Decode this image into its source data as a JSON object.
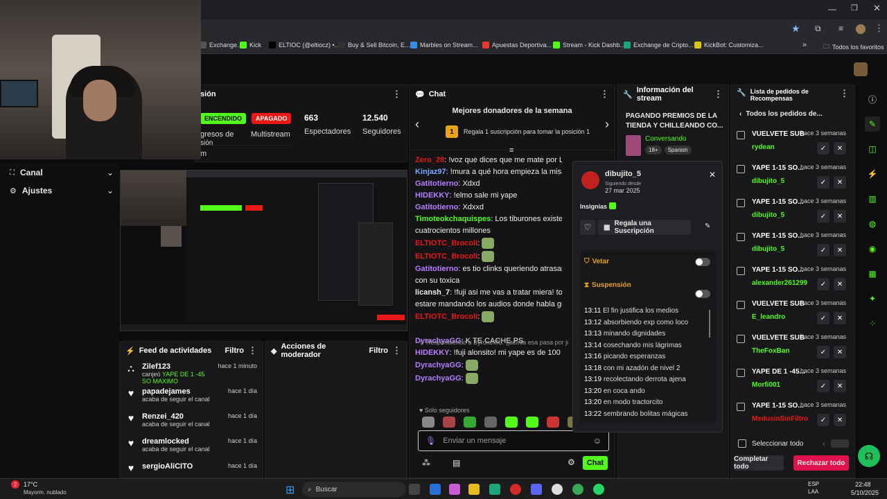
{
  "browser": {
    "bookmarks": [
      "Exchange...",
      "Kick",
      "ELTIOC (@eltiocz) •...",
      "Buy & Sell Bitcoin, E...",
      "Marbles on Stream...",
      "Apuestas Deportiva...",
      "Stream - Kick Dashb...",
      "Exchange de Cripto...",
      "KickBot: Customiza..."
    ],
    "all_favorites": "Todos los favoritos",
    "bookmark_colors": [
      "#555",
      "#53fc18",
      "#000",
      "#333",
      "#3a8be8",
      "#e63b2e",
      "#53fc18",
      "#1aa57a",
      "#d9c51a"
    ]
  },
  "sidebar": {
    "canal": "Canal",
    "ajustes": "Ajustes"
  },
  "session": {
    "title_fragment": "sión",
    "fragment_b1": "gresos de",
    "fragment_b2": "sión",
    "fragment_c": "m",
    "enabled": "ENCENDIDO",
    "disabled": "APAGADO",
    "multistream": "Multistream",
    "viewers": "663",
    "viewers_label": "Espectadores",
    "followers": "12.540",
    "followers_label": "Seguidores"
  },
  "feed": {
    "title": "Feed de actividades",
    "filter": "Filtro",
    "items": [
      {
        "name": "Zilef123",
        "sub": "canjeó",
        "reward": "YAPE DE 1 -45 SO MAXIMO",
        "time": "hace 1 minuto",
        "icon": "redeem"
      },
      {
        "name": "papadejames",
        "sub": "acaba de seguir el canal",
        "time": "hace 1 día",
        "icon": "heart"
      },
      {
        "name": "Renzei_420",
        "sub": "acaba de seguir el canal",
        "time": "hace 1 día",
        "icon": "heart"
      },
      {
        "name": "dreamlocked",
        "sub": "acaba de seguir el canal",
        "time": "hace 1 día",
        "icon": "heart"
      },
      {
        "name": "sergioAliCITO",
        "sub": "",
        "time": "hace 1 día",
        "icon": "heart"
      }
    ]
  },
  "mod": {
    "title": "Acciones de moderador",
    "filter": "Filtro"
  },
  "chat": {
    "title": "Chat",
    "donors_title": "Mejores donadores de la semana",
    "donors_rank": "1",
    "donors_text": "Regala 1 suscripción para tomar la posición 1",
    "reply_note": "Respondiendo a ByronJMC: ¡jacinta esa pasa por jug",
    "followers_only": "Solo seguidores",
    "placeholder": "Enviar un mensaje",
    "send": "Chat",
    "messages": [
      {
        "user": "Zero_28",
        "color": "#e91916",
        "text": "!voz que dices que me mate por Lia"
      },
      {
        "user": "Kinjaz97",
        "color": "#7aa7ff",
        "text": "!mura a qué hora empieza la misa"
      },
      {
        "user": "Gatitotierno",
        "color": "#b77cff",
        "text": "Xdxd"
      },
      {
        "user": "HIDEKKY",
        "color": "#b77cff",
        "text": "!elmo sale mi yape"
      },
      {
        "user": "Gatitotierno",
        "color": "#b77cff",
        "text": "Xdxxd"
      },
      {
        "user": "Timoteokchaquispes",
        "color": "#53fc18",
        "text": "Los tiburones existen des"
      },
      {
        "user": "",
        "color": "#eee",
        "text": "cuatrocientos millones"
      },
      {
        "user": "ELTIOTC_Brocoli",
        "color": "#e91916",
        "text": ""
      },
      {
        "user": "ELTIOTC_Brocoli",
        "color": "#e91916",
        "text": ""
      },
      {
        "user": "Gatitotierno",
        "color": "#b77cff",
        "text": "es tio clinks queriendo atrasar a parke"
      },
      {
        "user": "",
        "color": "#eee",
        "text": "con su toxica"
      },
      {
        "user": "licansh_7",
        "color": "#eee",
        "text": "!fuji asi me vas a tratar miera! todos a"
      },
      {
        "user": "",
        "color": "#eee",
        "text": "estare mandando los audios donde habla grueso el"
      },
      {
        "user": "ELTIOTC_Brocoli",
        "color": "#e91916",
        "text": ""
      },
      {
        "user": "DyrachyaGG",
        "color": "#b77cff",
        "text": "K TE CACHE PS"
      },
      {
        "user": "HIDEKKY",
        "color": "#b77cff",
        "text": "!fuji alonsito! mi yape es de 100 soles ojit"
      },
      {
        "user": "DyrachyaGG",
        "color": "#b77cff",
        "text": ""
      },
      {
        "user": "DyrachyaGG",
        "color": "#b77cff",
        "text": ""
      }
    ]
  },
  "stream_info": {
    "title": "Información del stream",
    "stream_title": "PAGANDO PREMIOS DE LA TIENDA Y CHILLEANDO CO...",
    "category": "Conversando",
    "tags": [
      "18+",
      "Spanish"
    ]
  },
  "popup": {
    "username": "dibujito_5",
    "since_label": "Siguiendo desde",
    "since_date": "27 mar 2025",
    "badges_label": "Insignias",
    "gift_sub": "Regala una Suscripción",
    "ban": "Vetar",
    "timeout": "Suspensión",
    "log": [
      {
        "t": "13:11",
        "m": "El fin justifica los medios"
      },
      {
        "t": "13:12",
        "m": "absorbiendo exp como loco"
      },
      {
        "t": "13:13",
        "m": "minando dignidades"
      },
      {
        "t": "13:14",
        "m": "cosechando mis lágrimas"
      },
      {
        "t": "13:16",
        "m": "picando esperanzas"
      },
      {
        "t": "13:18",
        "m": "con mi azadón de nivel 2"
      },
      {
        "t": "13:19",
        "m": "recolectando derrota ajena"
      },
      {
        "t": "13:20",
        "m": "en coca ando"
      },
      {
        "t": "13:20",
        "m": "en modo tractorcito"
      },
      {
        "t": "13:22",
        "m": "sembrando bolitas mágicas"
      }
    ]
  },
  "rewards": {
    "title": "Lista de pedidos de Recompensas",
    "back": "Todos los pedidos de...",
    "select_all": "Seleccionar todo",
    "complete_all": "Completar todo",
    "reject_all": "Rechazar todo",
    "items": [
      {
        "title": "VUELVETE SUB",
        "time": "hace 3 semanas",
        "user": "rydean",
        "color": "#53fc18"
      },
      {
        "title": "YAPE 1-15 SO...",
        "time": "hace 3 semanas",
        "user": "dibujito_5",
        "color": "#53fc18"
      },
      {
        "title": "YAPE 1-15 SO...",
        "time": "hace 3 semanas",
        "user": "dibujito_5",
        "color": "#53fc18"
      },
      {
        "title": "YAPE 1-15 SO...",
        "time": "hace 3 semanas",
        "user": "dibujito_5",
        "color": "#53fc18"
      },
      {
        "title": "YAPE 1-15 SO...",
        "time": "hace 3 semanas",
        "user": "alexander261299",
        "color": "#53fc18"
      },
      {
        "title": "VUELVETE SUB",
        "time": "hace 3 semanas",
        "user": "E_leandro",
        "color": "#53fc18"
      },
      {
        "title": "VUELVETE SUB",
        "time": "hace 3 semanas",
        "user": "TheFoxBan",
        "color": "#53fc18"
      },
      {
        "title": "YAPE DE 1 -45...",
        "time": "hace 3 semanas",
        "user": "Morfi001",
        "color": "#53fc18"
      },
      {
        "title": "YAPE 1-15 SO...",
        "time": "hace 3 semanas",
        "user": "MedusinSinFiltro",
        "color": "#e91916"
      }
    ]
  },
  "taskbar": {
    "temp": "17°C",
    "weather": "Mayorm. nublado",
    "search": "Buscar",
    "lang": "ESP",
    "region": "LAA",
    "time": "22:48",
    "date": "5/10/2025",
    "notif_count": "2"
  }
}
